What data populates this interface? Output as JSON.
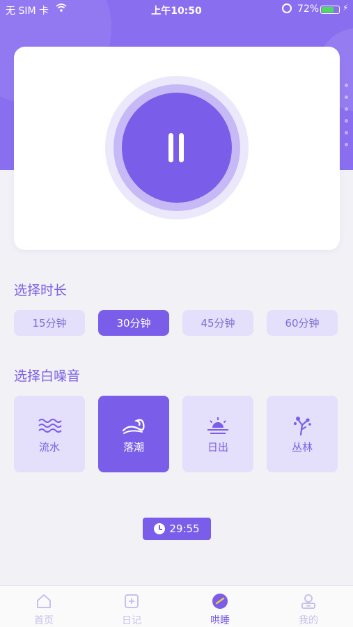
{
  "status_bar": {
    "carrier": "无 SIM 卡",
    "time": "上午10:50",
    "battery": "72%",
    "battery_level": 0.72
  },
  "player": {
    "state": "playing",
    "button_icon": "pause-icon"
  },
  "duration_section": {
    "title": "选择时长",
    "options": [
      {
        "label": "15分钟",
        "selected": false
      },
      {
        "label": "30分钟",
        "selected": true
      },
      {
        "label": "45分钟",
        "selected": false
      },
      {
        "label": "60分钟",
        "selected": false
      }
    ]
  },
  "noise_section": {
    "title": "选择白噪音",
    "options": [
      {
        "label": "流水",
        "icon": "water-waves-icon",
        "selected": false
      },
      {
        "label": "落潮",
        "icon": "tide-wave-icon",
        "selected": true
      },
      {
        "label": "日出",
        "icon": "sunrise-icon",
        "selected": false
      },
      {
        "label": "丛林",
        "icon": "jungle-tree-icon",
        "selected": false
      }
    ]
  },
  "timer": {
    "icon": "clock-icon",
    "remaining": "29:55"
  },
  "tab_bar": {
    "items": [
      {
        "label": "首页",
        "icon": "home-icon",
        "active": false
      },
      {
        "label": "日记",
        "icon": "diary-icon",
        "active": false
      },
      {
        "label": "哄睡",
        "icon": "sleep-icon",
        "active": true
      },
      {
        "label": "我的",
        "icon": "profile-icon",
        "active": false
      }
    ]
  },
  "colors": {
    "accent": "#7a5de8",
    "accent_light": "#e4dffb",
    "header": "#8a6ef0",
    "background": "#f2f1f6"
  }
}
